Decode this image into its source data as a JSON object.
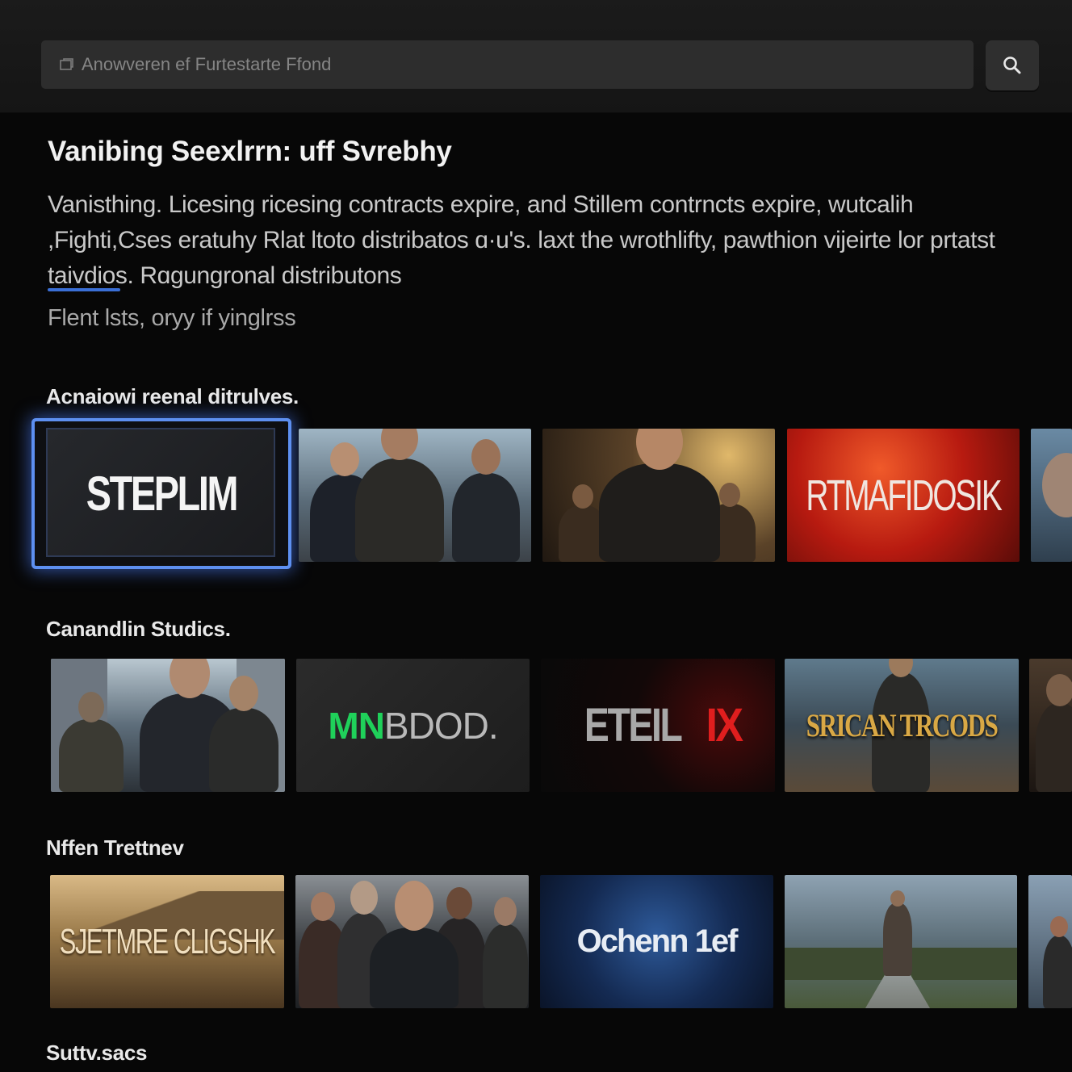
{
  "search": {
    "placeholder": "Anowveren ef Furtestarte Ffond"
  },
  "header": {
    "headline": "Vanibing Seexlrrn: uff Svrebhy",
    "description": "Vanisthing. Licesing ricesing contracts expire, and Stillem contrncts expire, wutcalih ,Fighti,Cses eratuhy Rlat ltoto distribatos ɑ·u's. laxt the wrothlifty, pawthion vijeirte lor prtatst taivdios. Rɑgungronal distributons",
    "subline": "Flent lsts, oryy if yinglrss"
  },
  "rows": [
    {
      "title": "Acnaiowi reenal ditrulves.",
      "tiles": [
        {
          "kind": "logo",
          "logo": "STEPLIM",
          "focused": true
        },
        {
          "kind": "scene",
          "scene": "men-suits"
        },
        {
          "kind": "scene",
          "scene": "man-warm"
        },
        {
          "kind": "logo",
          "logo": "RTMAFIDOSIK"
        },
        {
          "kind": "scene",
          "scene": "partial-face"
        }
      ]
    },
    {
      "title": "Canandlin Studics.",
      "tiles": [
        {
          "kind": "scene",
          "scene": "men-street"
        },
        {
          "kind": "logo",
          "logo_a": "MN",
          "logo_b": "BDOD."
        },
        {
          "kind": "logo",
          "logo_a": "ETEIL",
          "logo_b": "IX"
        },
        {
          "kind": "logo",
          "logo": "SRICAN TRCODS"
        },
        {
          "kind": "scene",
          "scene": "partial-dark"
        }
      ]
    },
    {
      "title": "Nffen Trettnev",
      "tiles": [
        {
          "kind": "logo",
          "logo": "SJETMRE CLIGSHK"
        },
        {
          "kind": "scene",
          "scene": "group-men"
        },
        {
          "kind": "logo",
          "logo": "Ochenn 1ef"
        },
        {
          "kind": "scene",
          "scene": "man-road"
        },
        {
          "kind": "scene",
          "scene": "partial-blue"
        }
      ]
    },
    {
      "title": "Suttv.sacs"
    }
  ],
  "colors": {
    "accent_focus": "#5d8ff0",
    "logo_green": "#1fd15a",
    "logo_red": "#e01e1e"
  },
  "icons": [
    "search-icon",
    "field-icon"
  ]
}
